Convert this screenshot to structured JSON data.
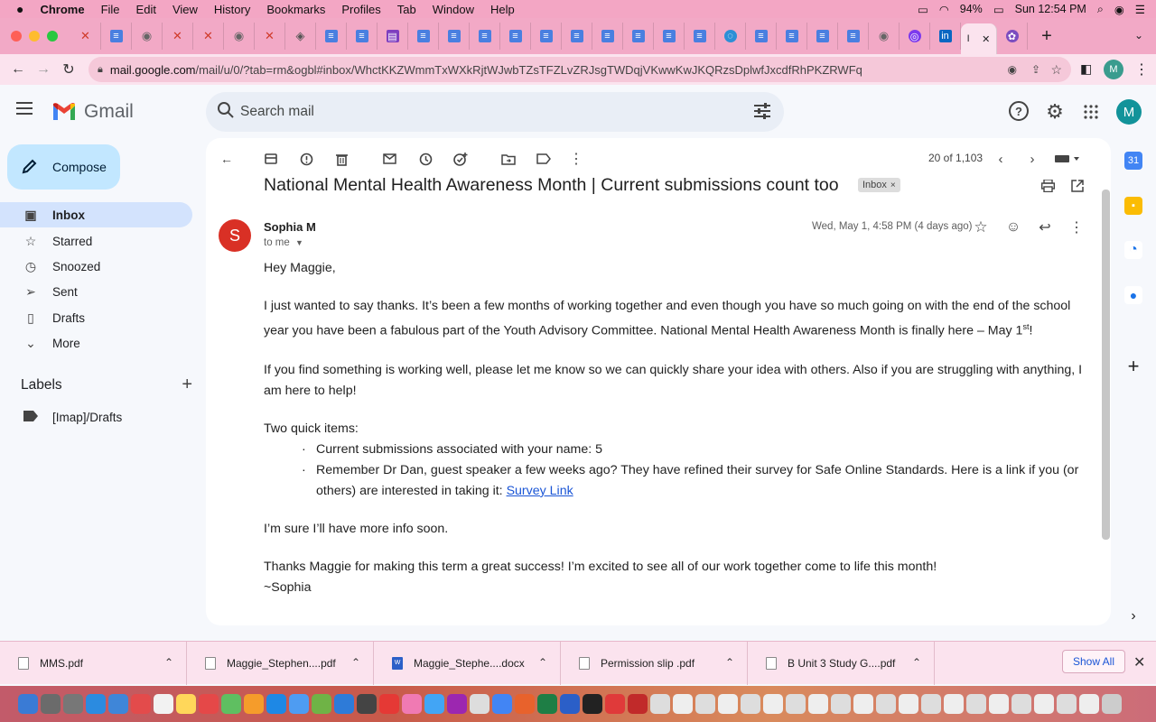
{
  "menubar": {
    "app": "Chrome",
    "items": [
      "File",
      "Edit",
      "View",
      "History",
      "Bookmarks",
      "Profiles",
      "Tab",
      "Window",
      "Help"
    ],
    "battery": "94%",
    "clock": "Sun 12:54 PM"
  },
  "browser": {
    "url_host": "mail.google.com",
    "url_path": "/mail/u/0/?tab=rm&ogbl#inbox/WhctKKZWmmTxWXkRjtWJwbTZsTFZLvZRJsgTWDqjVKwwKwJKQRzsDplwfJxcdfRhPKZRWFq",
    "profile_initial": "M",
    "active_tab_label": "I",
    "tabs": [
      "x",
      "doc",
      "circle",
      "x",
      "x",
      "circle",
      "x",
      "shield",
      "doc",
      "doc",
      "form",
      "doc",
      "doc",
      "doc",
      "doc",
      "doc",
      "doc",
      "doc",
      "doc",
      "doc",
      "doc",
      "edge",
      "doc",
      "doc",
      "doc",
      "doc",
      "circle",
      "q",
      "in"
    ]
  },
  "gmail": {
    "product": "Gmail",
    "search_placeholder": "Search mail",
    "account_initial": "M",
    "compose_label": "Compose",
    "nav": [
      {
        "label": "Inbox",
        "icon": "inbox-icon",
        "glyph": "▣"
      },
      {
        "label": "Starred",
        "icon": "star-icon",
        "glyph": "☆"
      },
      {
        "label": "Snoozed",
        "icon": "clock-icon",
        "glyph": "◷"
      },
      {
        "label": "Sent",
        "icon": "send-icon",
        "glyph": "➢"
      },
      {
        "label": "Drafts",
        "icon": "draft-icon",
        "glyph": "▯"
      },
      {
        "label": "More",
        "icon": "chevron-down-icon",
        "glyph": "⌄"
      }
    ],
    "labels_heading": "Labels",
    "labels": [
      {
        "label": "[Imap]/Drafts"
      }
    ],
    "pager": "20 of 1,103"
  },
  "email": {
    "subject": "National Mental Health Awareness Month | Current submissions count too",
    "chip": "Inbox",
    "avatar_initial": "S",
    "sender": "Sophia M",
    "to": "to me",
    "date": "Wed, May 1, 4:58 PM (4 days ago)",
    "greeting": "Hey Maggie,",
    "p1_main": "I just wanted to say thanks.  It’s been a few months of working together and even though you have so much going on with the end of the school year you have been a fabulous part of the Youth Advisory Committee.  National Mental Health Awareness Month is finally here – May 1",
    "p1_sup": "st",
    "p1_end": "!",
    "p2": "If you find something is working well, please let me know so we can quickly share your idea with others.  Also if you are struggling with anything, I am here to help!",
    "p3": "Two quick items:",
    "bullet_char": "·",
    "bullet1": "Current submissions associated with your name: 5",
    "bullet2": "Remember Dr Dan, guest speaker a few weeks ago? They have refined their survey for Safe Online Standards.  Here is a link if you (or others) are interested in taking it:  ",
    "survey_link": "Survey Link",
    "p4": "I’m sure I’ll have more info soon.",
    "p5": "Thanks Maggie for making this term a great success!  I’m excited to see all of our work together come to life this month!",
    "signoff": "~Sophia"
  },
  "downloads": {
    "items": [
      {
        "name": "MMS.pdf",
        "type": "pdf"
      },
      {
        "name": "Maggie_Stephen....pdf",
        "type": "pdf"
      },
      {
        "name": "Maggie_Stephe....docx",
        "type": "docx"
      },
      {
        "name": "Permission slip .pdf",
        "type": "pdf"
      },
      {
        "name": "B Unit 3 Study G....pdf",
        "type": "pdf"
      }
    ],
    "show_all": "Show All"
  },
  "colors": {
    "chrome_frame": "#f2a9c6",
    "compose_bg": "#c2e7ff",
    "inbox_active": "#d3e3fd",
    "avatar": "#d93025",
    "link": "#1a55d6"
  }
}
